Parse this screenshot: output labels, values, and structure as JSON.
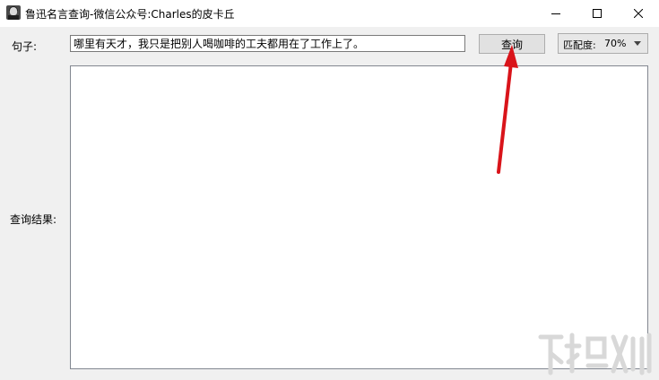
{
  "window": {
    "title": "鲁迅名言查询-微信公众号:Charles的皮卡丘",
    "controls": [
      "minimize",
      "maximize",
      "close"
    ]
  },
  "form": {
    "sentence_label": "句子:",
    "sentence_value": "哪里有天才，我只是把别人喝咖啡的工夫都用在了工作上了。",
    "query_button_label": "查询",
    "match_label": "匹配度:",
    "match_value": "70%",
    "result_label": "查询结果:",
    "result_value": ""
  },
  "annotation": {
    "arrow_color": "#d9141a"
  },
  "icons": [
    "app-icon",
    "minimize-icon",
    "maximize-icon",
    "close-icon",
    "chevron-down-icon"
  ]
}
